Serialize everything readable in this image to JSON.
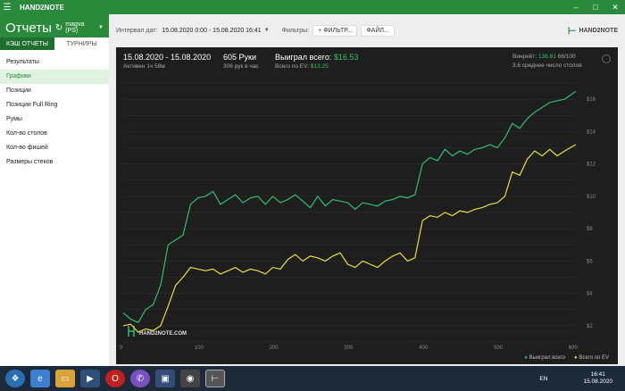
{
  "app": {
    "title": "HAND2NOTE"
  },
  "window_buttons": [
    "–",
    "□",
    "✕"
  ],
  "sidebar": {
    "title": "Отчеты",
    "user": "magva (PS)",
    "tabs": [
      {
        "label": "КЭШ ОТЧЕТЫ",
        "active": true
      },
      {
        "label": "ТУРНИРЫ",
        "active": false
      }
    ],
    "items": [
      {
        "label": "Результаты",
        "selected": false
      },
      {
        "label": "Графики",
        "selected": true
      },
      {
        "label": "Позиции",
        "selected": false
      },
      {
        "label": "Позиции Full Ring",
        "selected": false
      },
      {
        "label": "Румы",
        "selected": false
      },
      {
        "label": "Кол-во столов",
        "selected": false
      },
      {
        "label": "Кол-во фишей",
        "selected": false
      },
      {
        "label": "Размеры стеков",
        "selected": false
      }
    ]
  },
  "toolbar": {
    "interval_label": "Интервал дат:",
    "interval_value": "15.08.2020 0:00 - 15.08.2020 16:41",
    "filters_label": "Фильтры:",
    "filter_button": "ФИЛЬТР...",
    "file_button": "ФАЙЛ...",
    "logo_text": "HAND2NOTE"
  },
  "stats": {
    "date_range": "15.08.2020 - 15.08.2020",
    "active": "Активен 1ч 58м",
    "hands": "605 Руки",
    "hands_per_hour": "306 рук в час",
    "won_total_label": "Выиграл всего:",
    "won_total_value": "$16.53",
    "ev_total_label": "Всего по EV:",
    "ev_total_value": "$13.25",
    "winrate_label": "Винрейт:",
    "winrate_value": "136.61",
    "winrate_unit": "66/100",
    "avg_tables": "3.6 среднее число столов"
  },
  "chart_data": {
    "type": "line",
    "xlim": [
      0,
      605
    ],
    "ylim": [
      1,
      17
    ],
    "x_ticks": [
      0,
      100,
      200,
      300,
      400,
      500,
      600
    ],
    "y_ticks": [
      2,
      4,
      6,
      8,
      10,
      12,
      14,
      16
    ],
    "y_tick_labels": [
      "$2",
      "$4",
      "$6",
      "$8",
      "$10",
      "$12",
      "$14",
      "$16"
    ],
    "watermark": "HAND2NOTE.COM",
    "grid": true,
    "legend_placement": "bottom-right",
    "series": [
      {
        "name": "Выиграл всего",
        "color": "#2fbf71",
        "x": [
          0,
          10,
          20,
          30,
          40,
          50,
          60,
          70,
          80,
          90,
          100,
          110,
          120,
          130,
          140,
          150,
          160,
          170,
          180,
          190,
          200,
          210,
          220,
          230,
          240,
          250,
          260,
          270,
          280,
          290,
          300,
          310,
          320,
          330,
          340,
          350,
          360,
          370,
          380,
          390,
          400,
          410,
          420,
          430,
          440,
          450,
          460,
          470,
          480,
          490,
          500,
          510,
          520,
          530,
          540,
          550,
          560,
          570,
          580,
          590,
          605
        ],
        "y": [
          2.8,
          2.4,
          2.2,
          3.0,
          3.3,
          4.5,
          7.0,
          7.3,
          7.6,
          9.5,
          9.9,
          10.0,
          10.3,
          9.5,
          9.8,
          10.1,
          9.6,
          9.9,
          10.0,
          9.5,
          10.0,
          9.6,
          9.8,
          10.1,
          9.7,
          9.3,
          10.0,
          9.4,
          9.8,
          9.7,
          9.6,
          9.2,
          9.6,
          9.5,
          9.4,
          9.7,
          9.8,
          10.0,
          9.9,
          10.1,
          12.0,
          12.4,
          12.2,
          12.9,
          12.5,
          12.8,
          12.6,
          12.9,
          13.0,
          13.2,
          13.0,
          13.6,
          14.5,
          14.2,
          14.8,
          15.2,
          15.5,
          15.8,
          15.9,
          16.0,
          16.5
        ]
      },
      {
        "name": "Всего по EV",
        "color": "#e8e03a",
        "x": [
          0,
          10,
          20,
          30,
          40,
          50,
          60,
          70,
          80,
          90,
          100,
          110,
          120,
          130,
          140,
          150,
          160,
          170,
          180,
          190,
          200,
          210,
          220,
          230,
          240,
          250,
          260,
          270,
          280,
          290,
          300,
          310,
          320,
          330,
          340,
          350,
          360,
          370,
          380,
          390,
          400,
          410,
          420,
          430,
          440,
          450,
          460,
          470,
          480,
          490,
          500,
          510,
          520,
          530,
          540,
          550,
          560,
          570,
          580,
          590,
          605
        ],
        "y": [
          2.0,
          2.1,
          1.6,
          1.8,
          1.7,
          2.0,
          3.2,
          4.5,
          5.0,
          5.6,
          5.5,
          5.4,
          5.5,
          5.2,
          5.4,
          5.6,
          5.3,
          5.5,
          5.4,
          5.2,
          5.6,
          5.5,
          6.1,
          6.4,
          6.0,
          6.3,
          6.2,
          6.0,
          6.3,
          6.5,
          5.8,
          5.6,
          6.0,
          5.8,
          5.6,
          6.0,
          6.3,
          6.5,
          6.0,
          6.2,
          8.5,
          8.8,
          8.7,
          9.0,
          8.8,
          9.1,
          9.0,
          9.2,
          9.3,
          9.5,
          9.6,
          10.0,
          11.5,
          11.3,
          12.3,
          12.8,
          12.5,
          12.9,
          12.5,
          12.8,
          13.2
        ]
      }
    ]
  },
  "taskbar": {
    "language": "EN",
    "time": "16:41",
    "date": "15.08.2020"
  }
}
